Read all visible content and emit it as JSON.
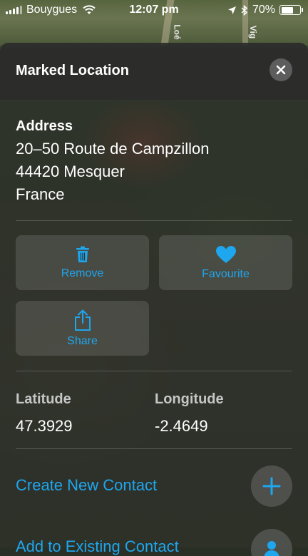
{
  "status_bar": {
    "carrier": "Bouygues",
    "time": "12:07 pm",
    "battery": "70%",
    "battery_level": 0.7
  },
  "map": {
    "labels": [
      "Loé",
      "Vig"
    ]
  },
  "sheet": {
    "title": "Marked Location",
    "address": {
      "label": "Address",
      "lines": [
        "20–50 Route de Campzillon",
        "44420 Mesquer",
        "France"
      ]
    },
    "actions": {
      "remove": "Remove",
      "favourite": "Favourite",
      "share": "Share"
    },
    "coordinates": {
      "latitude_label": "Latitude",
      "latitude": "47.3929",
      "longitude_label": "Longitude",
      "longitude": "-2.4649"
    },
    "create_contact": "Create New Contact",
    "add_existing_contact": "Add to Existing Contact"
  },
  "colors": {
    "accent": "#1ea6ee"
  },
  "icons": [
    "signal-icon",
    "wifi-icon",
    "location-arrow-icon",
    "bluetooth-icon",
    "battery-icon",
    "close-icon",
    "trash-icon",
    "heart-icon",
    "share-icon",
    "plus-icon",
    "person-icon"
  ]
}
